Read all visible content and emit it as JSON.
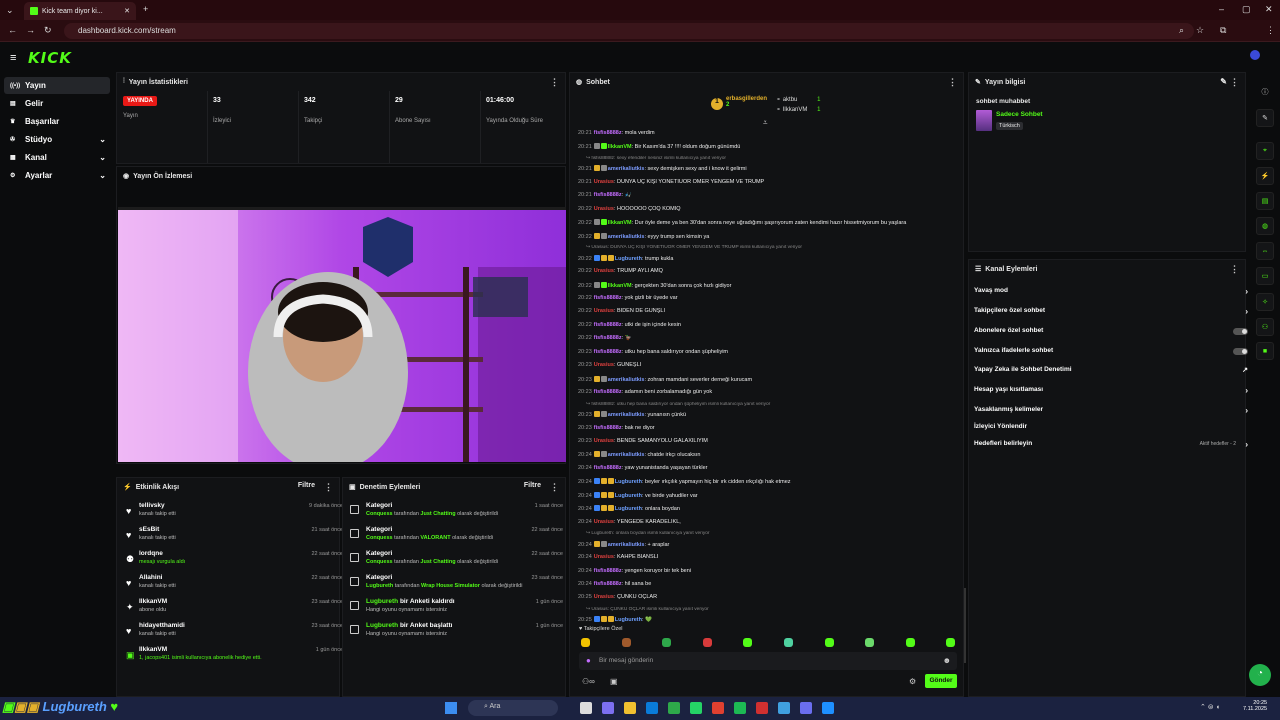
{
  "browser": {
    "tab_title": "Kick team diyor ki...",
    "url": "dashboard.kick.com/stream"
  },
  "app": {
    "logo": "KICK"
  },
  "sidebar": {
    "items": [
      {
        "label": "Yayın",
        "icon": "broadcast-icon",
        "active": true
      },
      {
        "label": "Gelir",
        "icon": "money-icon"
      },
      {
        "label": "Başarılar",
        "icon": "trophy-icon"
      },
      {
        "label": "Stüdyo",
        "icon": "studio-icon",
        "expandable": true
      },
      {
        "label": "Kanal",
        "icon": "channel-icon",
        "expandable": true
      },
      {
        "label": "Ayarlar",
        "icon": "gear-icon",
        "expandable": true
      }
    ]
  },
  "stats": {
    "title": "Yayın İstatistikleri",
    "live_badge": "YAYINDA",
    "live_label": "Yayın",
    "items": [
      {
        "value": "33",
        "label": "İzleyici"
      },
      {
        "value": "342",
        "label": "Takipçi"
      },
      {
        "value": "29",
        "label": "Abone Sayısı"
      },
      {
        "value": "01:46:00",
        "label": "Yayında Olduğu Süre"
      }
    ]
  },
  "preview": {
    "title": "Yayın Ön İzlemesi"
  },
  "activity": {
    "title": "Etkinlik Akışı",
    "filter": "Filtre",
    "items": [
      {
        "name": "tellivsky",
        "desc": "kanalı takip etti",
        "time": "9 dakika önce",
        "icon": "heart-icon"
      },
      {
        "name": "sEsBit",
        "desc": "kanalı takip etti",
        "time": "21 saat önce",
        "icon": "heart-icon"
      },
      {
        "name": "lordqne",
        "desc": "mesajı vurgula aldı",
        "time": "22 saat önce",
        "icon": "gift-icon"
      },
      {
        "name": "Allahini",
        "desc": "kanalı takip etti",
        "time": "22 saat önce",
        "icon": "heart-icon"
      },
      {
        "name": "IlkkanVM",
        "desc": "abone oldu",
        "time": "23 saat önce",
        "icon": "star-icon"
      },
      {
        "name": "hidayetthamidi",
        "desc": "kanalı takip etti",
        "time": "23 saat önce",
        "icon": "heart-icon"
      },
      {
        "name": "IlkkanVM",
        "desc": "1, jacops401 isimli kullanıcıya abonelik hediye etti.",
        "time": "1 gün önce",
        "icon": "gift-sub-icon"
      }
    ]
  },
  "moderation": {
    "title": "Denetim Eylemleri",
    "filter": "Filtre",
    "items": [
      {
        "name": "Kategori",
        "actor": "Conquess",
        "mid": " tarafından ",
        "value": "Just Chatting",
        "tail": " olarak değiştirildi",
        "time": "1 saat önce"
      },
      {
        "name": "Kategori",
        "actor": "Conquess",
        "mid": " tarafından ",
        "value": "VALORANT",
        "tail": " olarak değiştirildi",
        "time": "22 saat önce"
      },
      {
        "name": "Kategori",
        "actor": "Conquess",
        "mid": " tarafından ",
        "value": "Just Chatting",
        "tail": " olarak değiştirildi",
        "time": "22 saat önce"
      },
      {
        "name": "Kategori",
        "actor": "Lugbureth",
        "mid": " tarafından ",
        "value": "Wrap House Simulator",
        "tail": " olarak değiştirildi",
        "time": "23 saat önce"
      },
      {
        "name_user": "Lugbureth",
        "name_rest": " bir Anketi kaldırdı",
        "desc": "Hangi oyunu oynamamı istersiniz",
        "time": "1 gün önce"
      },
      {
        "name_user": "Lugbureth",
        "name_rest": " bir Anket başlattı",
        "desc": "Hangi oyunu oynamamı istersiniz",
        "time": "1 gün önce"
      }
    ]
  },
  "chat": {
    "title": "Sohbet",
    "leaders": [
      {
        "name": "erbasgillerden",
        "count": "2"
      },
      {
        "name": "aktbu",
        "count": "1"
      },
      {
        "name": "IlkkanVM",
        "count": "1"
      }
    ],
    "messages": [
      {
        "ts": "20:21",
        "user": "fisfis8888z",
        "color": "#c46dff",
        "text": ": mola verdim"
      },
      {
        "ts": "20:21",
        "user": "IlkkanVM",
        "color": "#53fc18",
        "text": ": Bir Kasım'da 37 !!!! oldum doğum günümdü"
      },
      {
        "reply": "fisfis8888z: sexy efendiler nesiniz isimli kullanıcıya yanıt veriyor"
      },
      {
        "ts": "20:21",
        "user": "amerikaliutkis",
        "color": "#7d9cff",
        "text": ": sexy demişken sexy and i know it gelirmi"
      },
      {
        "ts": "20:21",
        "user": "Urasius",
        "color": "#e0413f",
        "text": ": DÜNYA ÜÇ KİŞİ YÖNETİUOR ÖMER YENGEM VE TRUMP"
      },
      {
        "ts": "20:21",
        "user": "fisfis8888z",
        "color": "#c46dff",
        "text": ": 🎣"
      },
      {
        "ts": "20:22",
        "user": "Urasius",
        "color": "#e0413f",
        "text": ": HÖÖÖÖÖÖ ÇOQ KOMİQ"
      },
      {
        "ts": "20:22",
        "user": "IlkkanVM",
        "color": "#53fc18",
        "text": ": Dur öyle deme ya ben 30'dan sonra neye uğradığımı şaşırıyorum zaten kendimi hazır hissetmiyorum bu yaşlara"
      },
      {
        "ts": "20:22",
        "user": "amerikaliutkis",
        "color": "#7d9cff",
        "text": ": eyyy trump sen kimsin ya"
      },
      {
        "reply": "Urasius: DÜNYA ÜÇ KİŞİ YÖNETİUOR ÖMER YENGEM VE TRUMP isimli kullanıcıya yanıt veriyor"
      },
      {
        "ts": "20:22",
        "user": "Lugbureth",
        "color": "#6ea0ff",
        "text": ": trump kukla"
      },
      {
        "ts": "20:22",
        "user": "Urasius",
        "color": "#e0413f",
        "text": ": TRUMP AYLI AMQ"
      },
      {
        "ts": "20:22",
        "user": "IlkkanVM",
        "color": "#53fc18",
        "text": ": gerçekten 30'dan sonra çok hızlı gidiyor"
      },
      {
        "ts": "20:22",
        "user": "fisfis8888z",
        "color": "#c46dff",
        "text": ": yok gizli bir üyede var"
      },
      {
        "ts": "20:22",
        "user": "Urasius",
        "color": "#e0413f",
        "text": ": BİDEN DE GÜNŞLİ"
      },
      {
        "ts": "20:22",
        "user": "fisfis8888z",
        "color": "#c46dff",
        "text": ": utki de işin içinde kesin"
      },
      {
        "ts": "20:22",
        "user": "fisfis8888z",
        "color": "#c46dff",
        "text": ": 🦆"
      },
      {
        "ts": "20:23",
        "user": "fisfis8888z",
        "color": "#c46dff",
        "text": ": utku hep bana saldırıyor ondan şüpheliyim"
      },
      {
        "ts": "20:23",
        "user": "Urasius",
        "color": "#e0413f",
        "text": ": GÜNEŞLİ"
      },
      {
        "ts": "20:23",
        "user": "amerikaliutkis",
        "color": "#7d9cff",
        "text": ": zohran mamdani severler derneği kurucam"
      },
      {
        "ts": "20:23",
        "user": "fisfis8888z",
        "color": "#c46dff",
        "text": ": adamın beni zorbalamadığı gün yok"
      },
      {
        "reply": "fisfis8888z: utku hep bana saldırıyor ondan şüpheliyim isimli kullanıcıya yanıt veriyor"
      },
      {
        "ts": "20:23",
        "user": "amerikaliutkis",
        "color": "#7d9cff",
        "text": ": yunanısn çünkü"
      },
      {
        "ts": "20:23",
        "user": "fisfis8888z",
        "color": "#c46dff",
        "text": ": bak ne diyor"
      },
      {
        "ts": "20:23",
        "user": "Urasius",
        "color": "#e0413f",
        "text": ": BENDE SAMANYOLU GALAXİLİYİM"
      },
      {
        "ts": "20:24",
        "user": "amerikaliutkis",
        "color": "#7d9cff",
        "text": ": chatde irkçı olucaksın"
      },
      {
        "ts": "20:24",
        "user": "fisfis8888z",
        "color": "#c46dff",
        "text": ": yaw yunanistanda yaşayan türkler"
      },
      {
        "ts": "20:24",
        "user": "Lugbureth",
        "color": "#6ea0ff",
        "text": ": beyler ırkçılık yapmayın hiç bir ırk cidden ırkçılığı hak etmez"
      },
      {
        "ts": "20:24",
        "user": "Lugbureth",
        "color": "#6ea0ff",
        "text": ": ve birde yahudiler var"
      },
      {
        "ts": "20:24",
        "user": "Lugbureth",
        "color": "#6ea0ff",
        "text": ": onlara boydan"
      },
      {
        "ts": "20:24",
        "user": "Urasius",
        "color": "#e0413f",
        "text": ": YENGEDE KARADELİKL,"
      },
      {
        "reply": "Lugbureth: onlara boydan isimli kullanıcıya yanıt veriyor"
      },
      {
        "ts": "20:24",
        "user": "amerikaliutkis",
        "color": "#7d9cff",
        "text": ": + araplar"
      },
      {
        "ts": "20:24",
        "user": "Urasius",
        "color": "#e0413f",
        "text": ": KAHPE BİANSLI"
      },
      {
        "ts": "20:24",
        "user": "fisfis8888z",
        "color": "#c46dff",
        "text": ": yengen koruyor bir tek beni"
      },
      {
        "ts": "20:24",
        "user": "fisfis8888z",
        "color": "#c46dff",
        "text": ": hil sana be"
      },
      {
        "ts": "20:25",
        "user": "Urasius",
        "color": "#e0413f",
        "text": ": ÇÜNKÜ OÇLAR"
      },
      {
        "reply": "Urasius: ÇÜNKÜ OÇLAR isimli kullanıcıya yanıt veriyor"
      },
      {
        "ts": "20:25",
        "user": "Lugbureth",
        "color": "#6ea0ff",
        "text": ": 💚"
      }
    ],
    "followers_only": "Takipçilere Özel",
    "input_placeholder": "Bir mesaj gönderin",
    "send_label": "Gönder"
  },
  "stream_info": {
    "title": "Yayın bilgisi",
    "stream_title": "sohbet muhabbet",
    "category": "Sadece Sohbet",
    "language": "Türkisch"
  },
  "channel_actions": {
    "title": "Kanal Eylemleri",
    "items": [
      {
        "label": "Yavaş mod",
        "control": "arrow"
      },
      {
        "label": "Takipçilere özel sohbet",
        "control": "arrow"
      },
      {
        "label": "Abonelere özel sohbet",
        "control": "toggle"
      },
      {
        "label": "Yalnızca ifadelerle sohbet",
        "control": "toggle"
      },
      {
        "label": "Yapay Zeka ile Sohbet Denetimi",
        "control": "external"
      },
      {
        "label": "Hesap yaşı kısıtlaması",
        "control": "arrow"
      },
      {
        "label": "Yasaklanmış kelimeler",
        "control": "arrow"
      },
      {
        "label": "İzleyici Yönlendir",
        "control": "none"
      },
      {
        "label": "Hedefleri belirleyin",
        "control": "arrow",
        "extra": "Aktif hedefler - 2"
      }
    ]
  },
  "taskbar": {
    "overlay_name": "Lugbureth",
    "search": "Ara",
    "time": "20:25",
    "date": "7.11.2025"
  },
  "colors": {
    "brand": "#53fc18",
    "live": "#e91916",
    "browser": "#2a0c10"
  }
}
